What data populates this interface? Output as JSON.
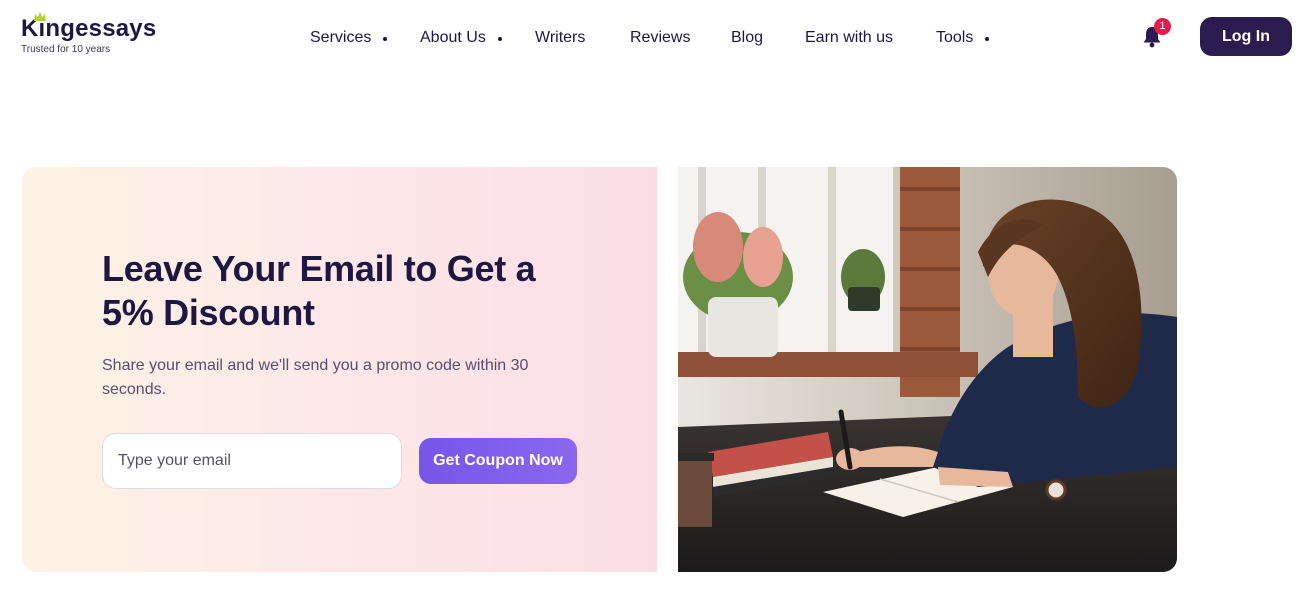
{
  "header": {
    "logo": {
      "name": "Kingessays",
      "tagline": "Trusted for 10 years",
      "icon": "crown-icon"
    },
    "nav": [
      {
        "label": "Services",
        "has_dropdown": true
      },
      {
        "label": "About Us",
        "has_dropdown": true
      },
      {
        "label": "Writers",
        "has_dropdown": false
      },
      {
        "label": "Reviews",
        "has_dropdown": false
      },
      {
        "label": "Blog",
        "has_dropdown": false
      },
      {
        "label": "Earn with us",
        "has_dropdown": false
      },
      {
        "label": "Tools",
        "has_dropdown": true
      }
    ],
    "notifications": {
      "icon": "bell-icon",
      "count": "1"
    },
    "login_label": "Log In"
  },
  "promo": {
    "title": "Leave Your Email to Get a 5% Discount",
    "subtitle": "Share your email and we'll send you a promo code within 30 seconds.",
    "email_placeholder": "Type your email",
    "email_value": "",
    "button_label": "Get Coupon Now"
  },
  "photo": {
    "subject": "woman-writing-in-notebook"
  },
  "colors": {
    "brand_dark": "#2a1c4f",
    "text_dark": "#1e1742",
    "accent_purple": "#7556e8",
    "badge_red": "#e8194f",
    "promo_gradient_start": "#fdf3e4",
    "promo_gradient_end": "#fbdde6"
  }
}
